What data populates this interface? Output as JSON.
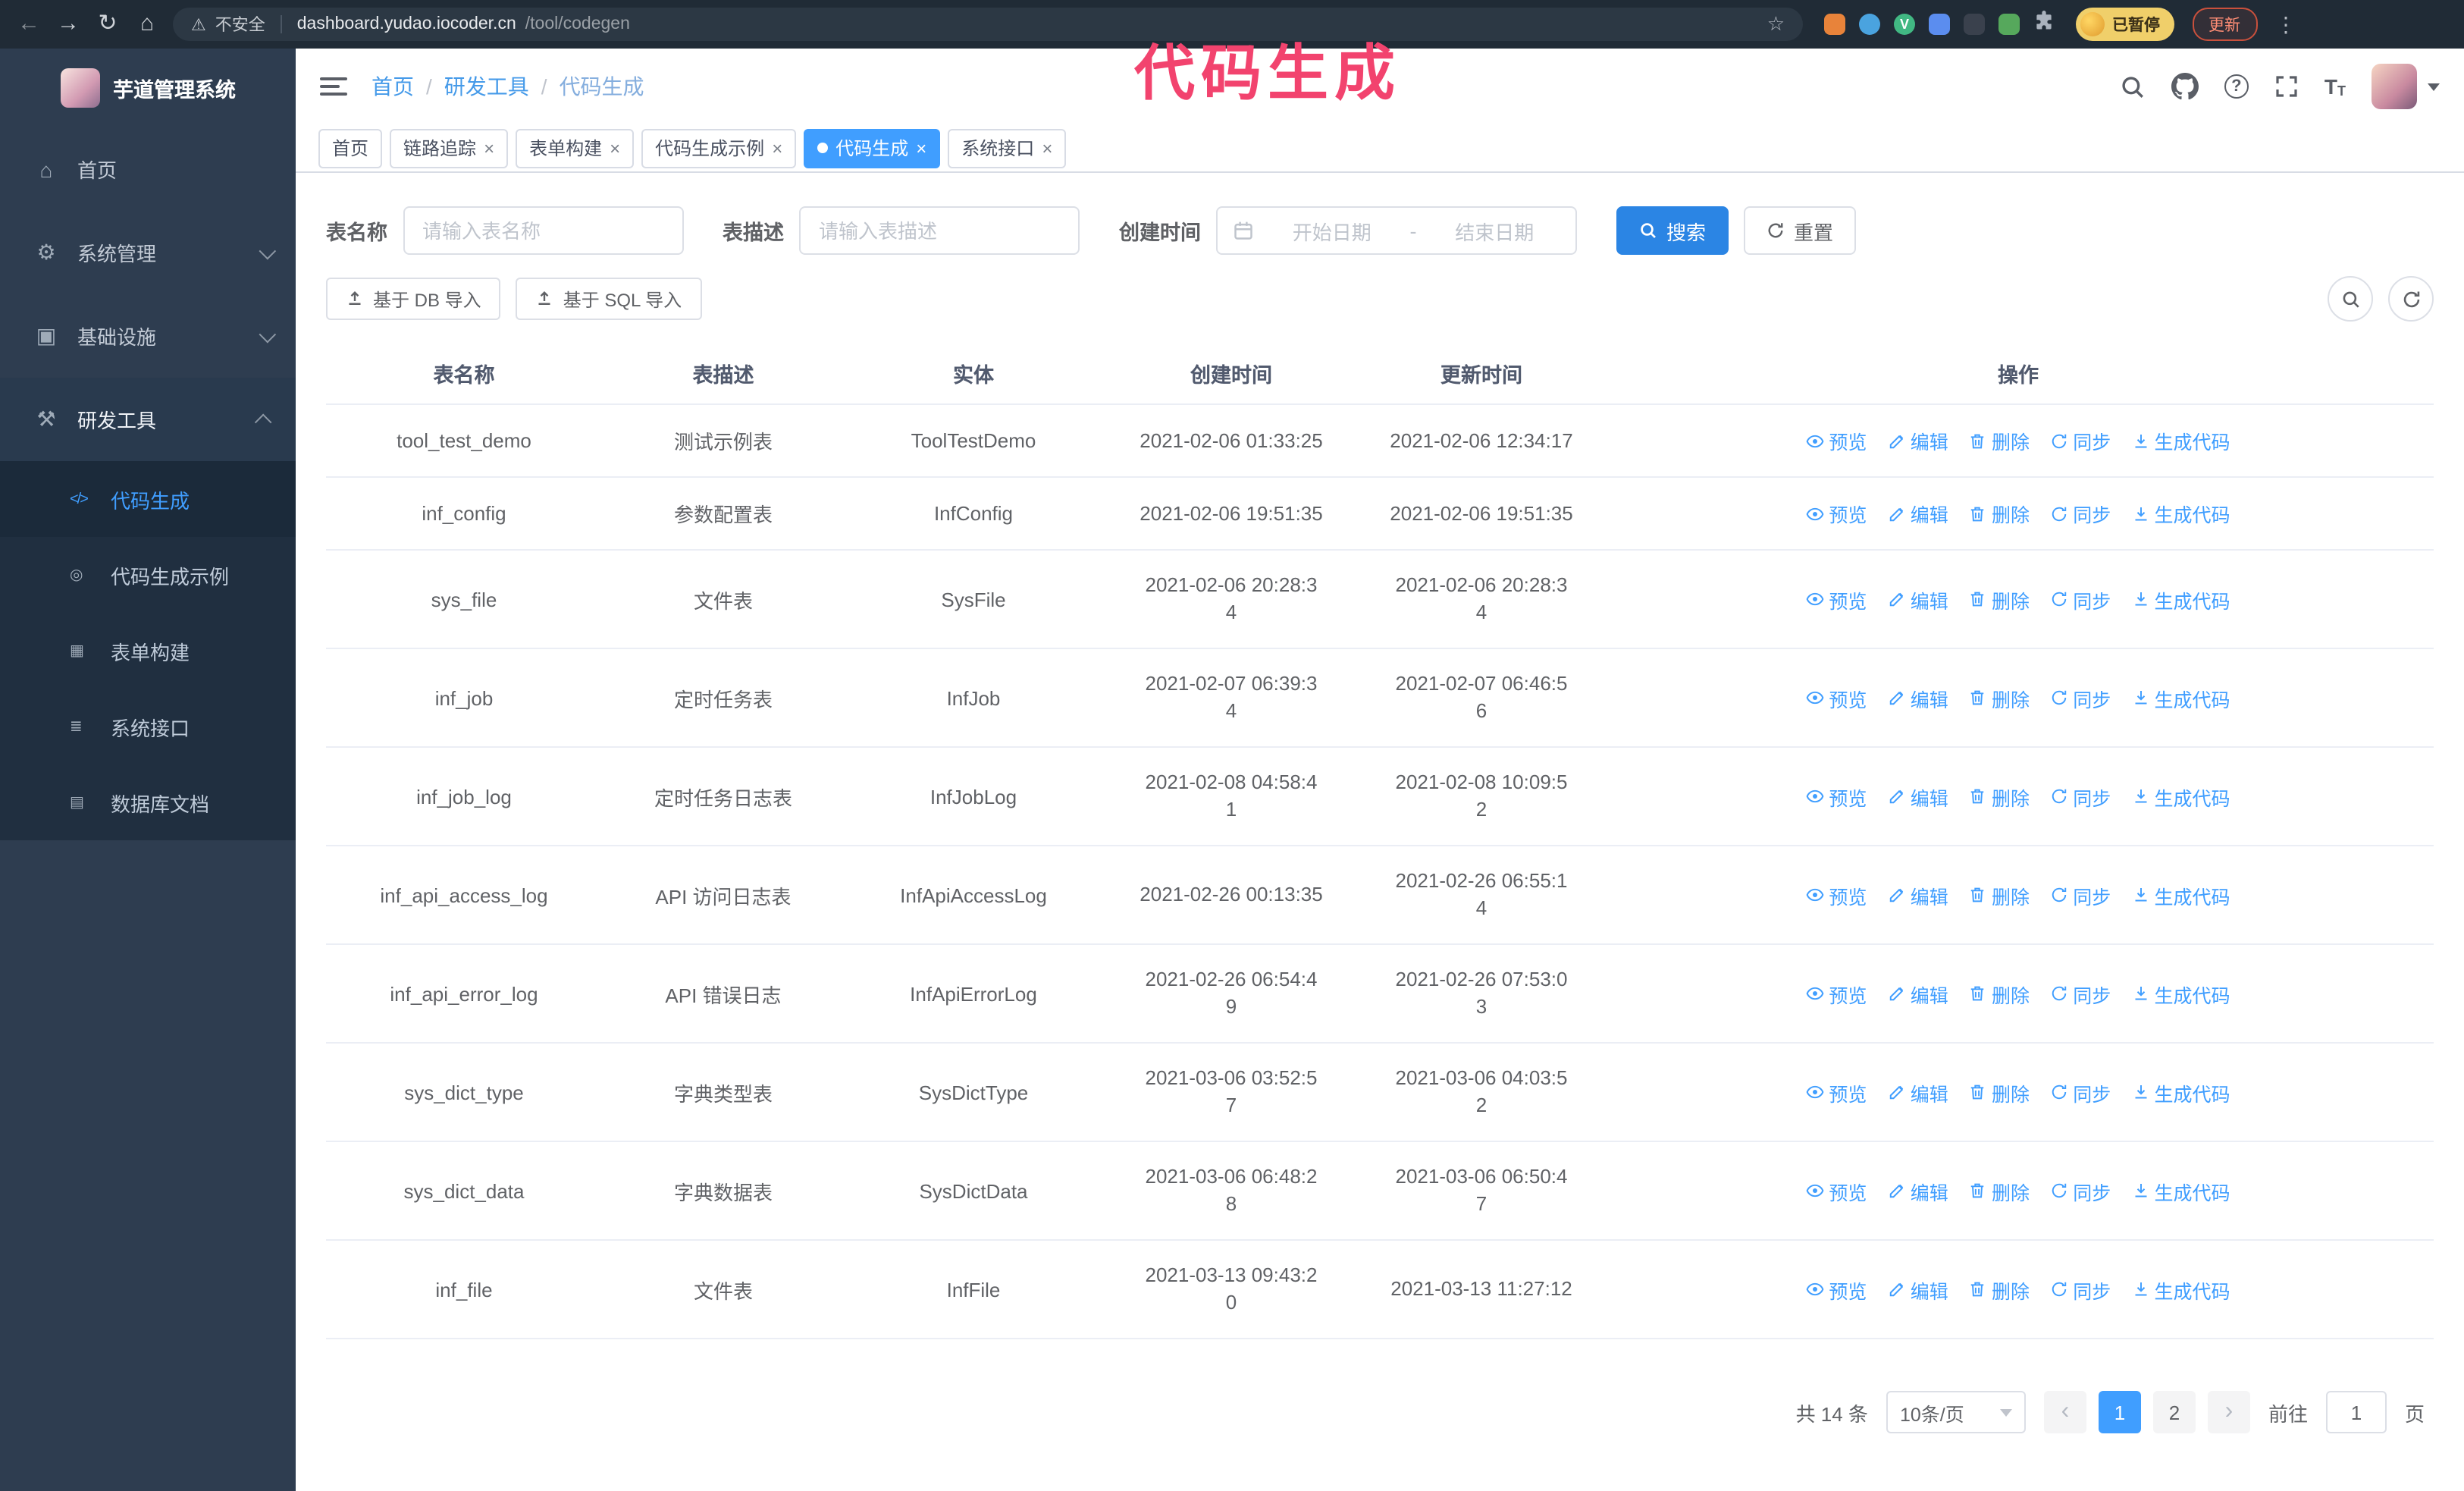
{
  "colors": {
    "primary": "#409eff",
    "search_button": "#2b85e4",
    "annotation": "#f2436e",
    "sidebar_bg": "#2e3d50",
    "submenu_bg": "#202f40",
    "chrome_bg": "#202b36",
    "active_tab": "#409eff"
  },
  "browser": {
    "back_icon": "←",
    "forward_icon": "→",
    "reload_icon": "↻",
    "home_icon": "⌂",
    "security_icon": "⚠",
    "security_label": "不安全",
    "url_host": "dashboard.yudao.iocoder.cn",
    "url_path": "/tool/codegen",
    "star_icon": "☆",
    "extensions": [
      {
        "name": "extension-orange",
        "color": "#e8833a"
      },
      {
        "name": "extension-blue",
        "color": "#4aa3df"
      },
      {
        "name": "extension-vue-devtools",
        "color": "#41b883",
        "letter": "V"
      },
      {
        "name": "extension-people",
        "color": "#5b8def"
      },
      {
        "name": "extension-dark",
        "color": "#3a414d"
      },
      {
        "name": "extension-leaf",
        "color": "#56a85c"
      }
    ],
    "profile_chip_label": "已暂停",
    "update_button_label": "更新",
    "menu_icon": "⋮"
  },
  "annotation": {
    "text": "代码生成"
  },
  "sidebar": {
    "logo_title": "芋道管理系统",
    "menu": [
      {
        "label": "首页",
        "icon_glyph": "⌂"
      },
      {
        "label": "系统管理",
        "icon_glyph": "⚙"
      },
      {
        "label": "基础设施",
        "icon_glyph": "▣"
      },
      {
        "label": "研发工具",
        "icon_glyph": "⚒"
      }
    ],
    "submenu": [
      {
        "label": "代码生成",
        "icon_glyph": "</>"
      },
      {
        "label": "代码生成示例",
        "icon_glyph": "◎"
      },
      {
        "label": "表单构建",
        "icon_glyph": "▦"
      },
      {
        "label": "系统接口",
        "icon_glyph": "≣"
      },
      {
        "label": "数据库文档",
        "icon_glyph": "▤"
      }
    ]
  },
  "header": {
    "breadcrumb": [
      "首页",
      "研发工具",
      "代码生成"
    ],
    "breadcrumb_separator": "/",
    "help_icon": "?",
    "font_size_icon": "T",
    "close_glyph": "×",
    "tabs": [
      {
        "label": "首页"
      },
      {
        "label": "链路追踪"
      },
      {
        "label": "表单构建"
      },
      {
        "label": "代码生成示例"
      },
      {
        "label": "代码生成"
      },
      {
        "label": "系统接口"
      }
    ]
  },
  "filters": {
    "name_label": "表名称",
    "name_placeholder": "请输入表名称",
    "desc_label": "表描述",
    "desc_placeholder": "请输入表描述",
    "time_label": "创建时间",
    "start_placeholder": "开始日期",
    "range_separator": "-",
    "end_placeholder": "结束日期",
    "search_button": "搜索",
    "reset_button": "重置"
  },
  "toolbar": {
    "import_db": "基于 DB 导入",
    "import_sql": "基于 SQL 导入"
  },
  "table": {
    "columns": [
      "表名称",
      "表描述",
      "实体",
      "创建时间",
      "更新时间",
      "操作"
    ],
    "actions": [
      "预览",
      "编辑",
      "删除",
      "同步",
      "生成代码"
    ],
    "rows": [
      {
        "name": "tool_test_demo",
        "desc": "测试示例表",
        "entity": "ToolTestDemo",
        "created": "2021-02-06 01:33:25",
        "updated": "2021-02-06 12:34:17"
      },
      {
        "name": "inf_config",
        "desc": "参数配置表",
        "entity": "InfConfig",
        "created": "2021-02-06 19:51:35",
        "updated": "2021-02-06 19:51:35"
      },
      {
        "name": "sys_file",
        "desc": "文件表",
        "entity": "SysFile",
        "created": "2021-02-06 20:28:3\n4",
        "updated": "2021-02-06 20:28:3\n4"
      },
      {
        "name": "inf_job",
        "desc": "定时任务表",
        "entity": "InfJob",
        "created": "2021-02-07 06:39:3\n4",
        "updated": "2021-02-07 06:46:5\n6"
      },
      {
        "name": "inf_job_log",
        "desc": "定时任务日志表",
        "entity": "InfJobLog",
        "created": "2021-02-08 04:58:4\n1",
        "updated": "2021-02-08 10:09:5\n2"
      },
      {
        "name": "inf_api_access_log",
        "desc": "API 访问日志表",
        "entity": "InfApiAccessLog",
        "created": "2021-02-26 00:13:35",
        "updated": "2021-02-26 06:55:1\n4"
      },
      {
        "name": "inf_api_error_log",
        "desc": "API 错误日志",
        "entity": "InfApiErrorLog",
        "created": "2021-02-26 06:54:4\n9",
        "updated": "2021-02-26 07:53:0\n3"
      },
      {
        "name": "sys_dict_type",
        "desc": "字典类型表",
        "entity": "SysDictType",
        "created": "2021-03-06 03:52:5\n7",
        "updated": "2021-03-06 04:03:5\n2"
      },
      {
        "name": "sys_dict_data",
        "desc": "字典数据表",
        "entity": "SysDictData",
        "created": "2021-03-06 06:48:2\n8",
        "updated": "2021-03-06 06:50:4\n7"
      },
      {
        "name": "inf_file",
        "desc": "文件表",
        "entity": "InfFile",
        "created": "2021-03-13 09:43:2\n0",
        "updated": "2021-03-13 11:27:12"
      }
    ]
  },
  "pagination": {
    "total": "共 14 条",
    "page_size": "10条/页",
    "prev_icon": "‹",
    "next_icon": "›",
    "pages": [
      "1",
      "2"
    ],
    "goto_label": "前往",
    "goto_value": "1",
    "goto_suffix": "页"
  }
}
